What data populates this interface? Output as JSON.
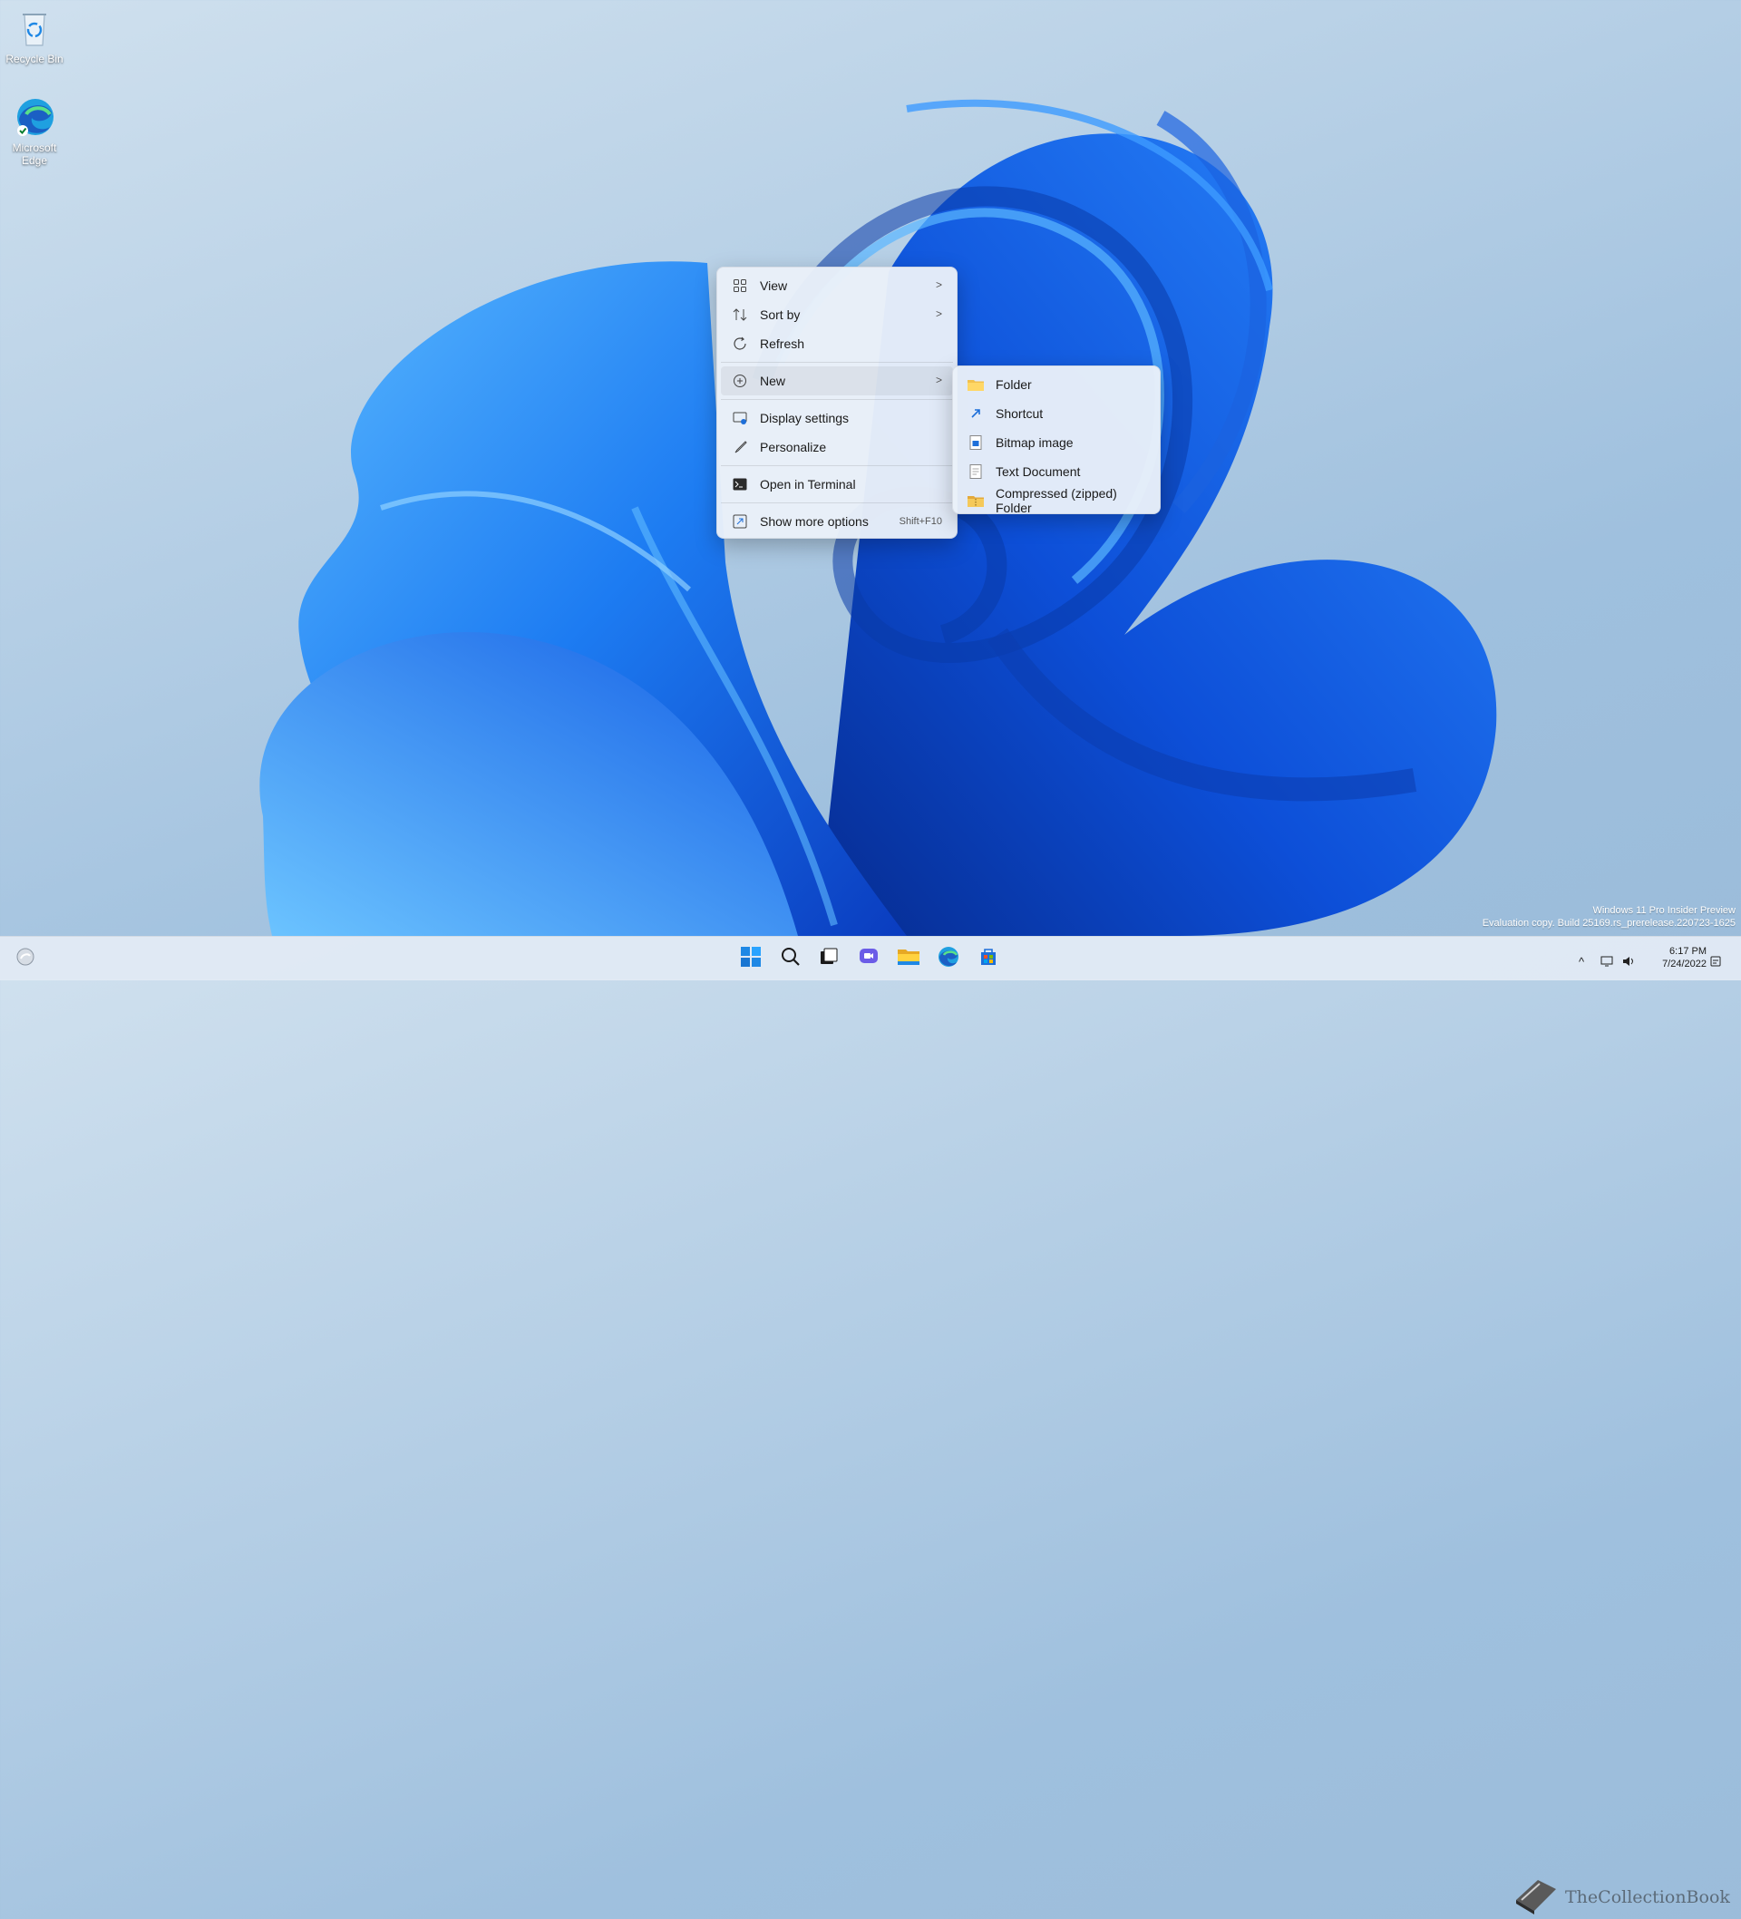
{
  "desktop": {
    "icons": [
      {
        "label": "Recycle Bin",
        "icon": "recycle-bin-icon"
      },
      {
        "label": "Microsoft Edge",
        "icon": "edge-icon"
      }
    ]
  },
  "context_menu": {
    "items": [
      {
        "label": "View",
        "icon": "view-grid-icon",
        "submenu": true
      },
      {
        "label": "Sort by",
        "icon": "sort-icon",
        "submenu": true
      },
      {
        "label": "Refresh",
        "icon": "refresh-icon"
      },
      {
        "label": "New",
        "icon": "new-plus-icon",
        "submenu": true,
        "highlighted": true
      },
      {
        "label": "Display settings",
        "icon": "display-settings-icon"
      },
      {
        "label": "Personalize",
        "icon": "personalize-brush-icon"
      },
      {
        "label": "Open in Terminal",
        "icon": "terminal-icon"
      },
      {
        "label": "Show more options",
        "icon": "more-options-icon",
        "shortcut": "Shift+F10"
      }
    ],
    "chevron": ">"
  },
  "new_submenu": {
    "items": [
      {
        "label": "Folder",
        "icon": "folder-icon"
      },
      {
        "label": "Shortcut",
        "icon": "shortcut-icon"
      },
      {
        "label": "Bitmap image",
        "icon": "bitmap-icon"
      },
      {
        "label": "Text Document",
        "icon": "text-document-icon"
      },
      {
        "label": "Compressed (zipped) Folder",
        "icon": "zip-folder-icon"
      }
    ]
  },
  "watermark": {
    "line1": "Windows 11 Pro Insider Preview",
    "line2": "Evaluation copy. Build 25169.rs_prerelease.220723-1625"
  },
  "taskbar": {
    "apps": [
      "start-icon",
      "search-icon",
      "task-view-icon",
      "chat-icon",
      "file-explorer-icon",
      "edge-icon",
      "store-icon"
    ],
    "clock": {
      "time": "6:17 PM",
      "date": "7/24/2022"
    },
    "overlay_text": "TheCollectionBook"
  },
  "colors": {
    "accent": "#0067c0",
    "bloom_dark": "#0a3fb8",
    "bloom_light": "#3aa3ff"
  }
}
